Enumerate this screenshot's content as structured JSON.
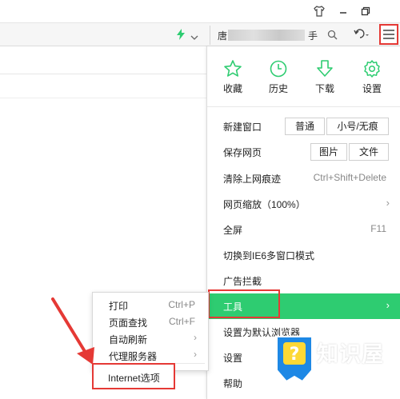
{
  "titlebar": {
    "icons": [
      "shirt-icon",
      "minimize-icon",
      "restore-icon"
    ]
  },
  "addressbar": {
    "search_prefix": "唐",
    "search_suffix": "手",
    "icons": [
      "lightning-icon",
      "chevron-down-icon",
      "search-icon",
      "undo-icon",
      "menu-icon"
    ]
  },
  "menu": {
    "quick_actions": [
      {
        "label": "收藏",
        "icon": "star-icon"
      },
      {
        "label": "历史",
        "icon": "clock-icon"
      },
      {
        "label": "下载",
        "icon": "download-icon"
      },
      {
        "label": "设置",
        "icon": "gear-icon"
      }
    ],
    "new_window": {
      "label": "新建窗口",
      "chip1": "普通",
      "chip2": "小号/无痕"
    },
    "save_page": {
      "label": "保存网页",
      "chip1": "图片",
      "chip2": "文件"
    },
    "clear_history": {
      "label": "清除上网痕迹",
      "shortcut": "Ctrl+Shift+Delete"
    },
    "zoom": {
      "label": "网页缩放（100%）",
      "arrow": "›"
    },
    "fullscreen": {
      "label": "全屏",
      "shortcut": "F11"
    },
    "ie6": {
      "label": "切换到IE6多窗口模式"
    },
    "adblock": {
      "label": "广告拦截"
    },
    "tools": {
      "label": "工具",
      "arrow": "›"
    },
    "default_browser": {
      "label": "设置为默认浏览器"
    },
    "settings": {
      "label": "设置"
    },
    "help": {
      "label": "帮助"
    }
  },
  "submenu": {
    "print": {
      "label": "打印",
      "shortcut": "Ctrl+P"
    },
    "find": {
      "label": "页面查找",
      "shortcut": "Ctrl+F"
    },
    "auto_refresh": {
      "label": "自动刷新",
      "arrow": "›"
    },
    "proxy": {
      "label": "代理服务器",
      "arrow": "›"
    },
    "internet_options": {
      "label": "Internet选项"
    }
  },
  "watermark": {
    "title": "知识屋",
    "url": "zhishiwu.com"
  },
  "colors": {
    "accent_green": "#2ecc71",
    "highlight_red": "#e53935"
  }
}
